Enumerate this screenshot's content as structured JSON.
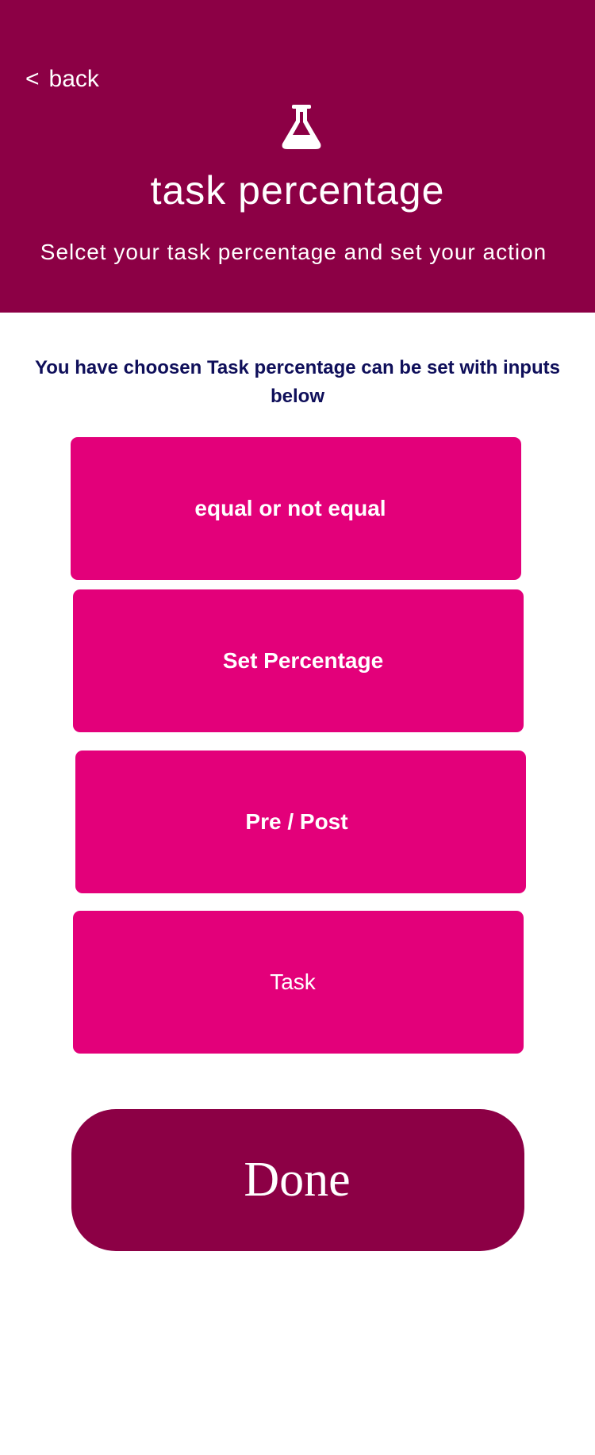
{
  "header": {
    "back_label": "back",
    "back_chevron": "<",
    "icon": "flask-icon",
    "title": "task percentage",
    "subtitle": "Selcet your task percentage and set your action"
  },
  "instruction": "You have choosen Task percentage can be set with inputs below",
  "options": [
    {
      "label": "equal or not equal"
    },
    {
      "label": "Set Percentage"
    },
    {
      "label": "Pre / Post"
    },
    {
      "label": "Task"
    }
  ],
  "done_label": "Done",
  "colors": {
    "header_bg": "#8c0045",
    "option_bg": "#e3007a",
    "done_bg": "#8c0045",
    "instruction_text": "#0f0f5a",
    "text_light": "#ffffff"
  }
}
